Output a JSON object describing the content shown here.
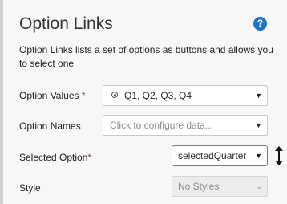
{
  "header": {
    "title": "Option Links",
    "help_icon": "?"
  },
  "description": "Option Links lists a set of options as buttons and allows you to select one",
  "fields": {
    "option_values": {
      "label": "Option Values",
      "required_mark": "*",
      "value": "Q1, Q2, Q3, Q4",
      "icon": "radio-icon"
    },
    "option_names": {
      "label": "Option Names",
      "placeholder": "Click to configure data..."
    },
    "selected_option": {
      "label": "Selected Option",
      "required_mark": "*",
      "value": "selectedQuarter"
    },
    "style": {
      "label": "Style",
      "value": "No Styles"
    }
  },
  "colors": {
    "accent": "#3c88d6",
    "help": "#1f74c2",
    "required": "#dd2222"
  }
}
